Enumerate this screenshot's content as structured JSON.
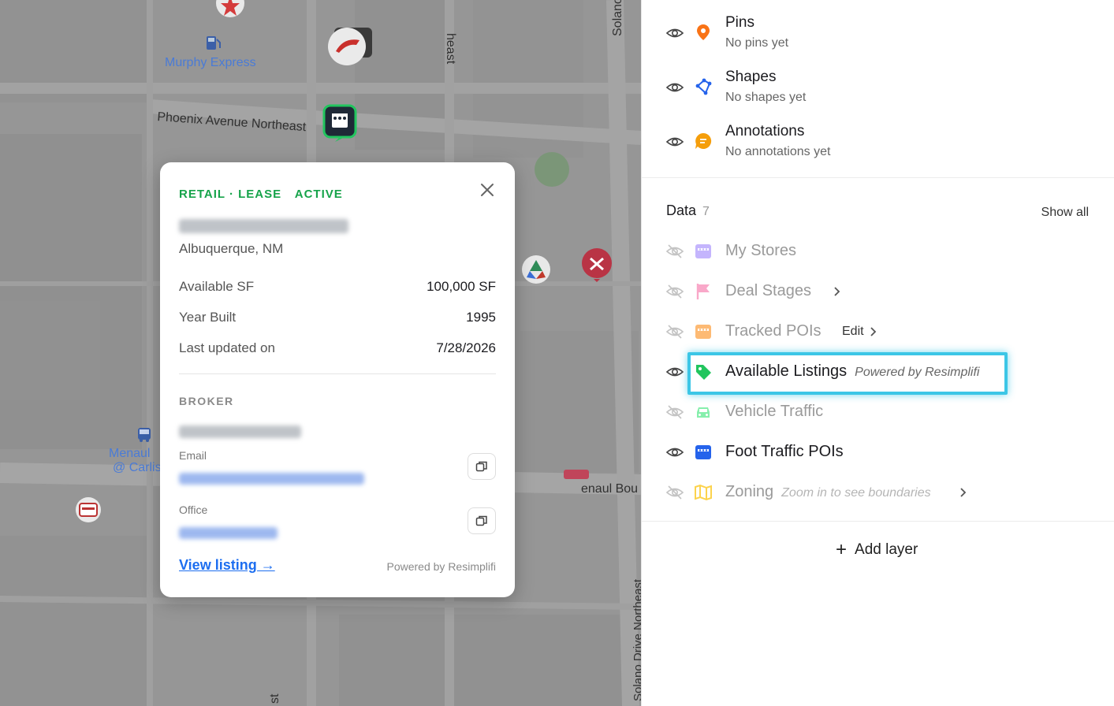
{
  "map": {
    "labels": {
      "murphy": "Murphy Express",
      "phoenix": "Phoenix Avenue Northeast",
      "menaul_1": "Menaul",
      "menaul_2": "@ Carlis",
      "renaul": "enaul Bou",
      "solano_top": "Solano",
      "east_top": "heast",
      "solano_drive": "Solano Drive Northeast",
      "st_bottom": "st"
    }
  },
  "popup": {
    "tags": {
      "category": "RETAIL · LEASE",
      "status": "ACTIVE"
    },
    "city": "Albuquerque, NM",
    "rows": [
      {
        "label": "Available SF",
        "value": "100,000 SF"
      },
      {
        "label": "Year Built",
        "value": "1995"
      },
      {
        "label": "Last updated on",
        "value": "7/28/2026"
      }
    ],
    "broker": {
      "section": "BROKER",
      "email_label": "Email",
      "office_label": "Office"
    },
    "view_listing": "View listing →",
    "powered": "Powered by Resimplifi"
  },
  "panel": {
    "user_layers": [
      {
        "title": "Pins",
        "subtitle": "No pins yet"
      },
      {
        "title": "Shapes",
        "subtitle": "No shapes yet"
      },
      {
        "title": "Annotations",
        "subtitle": "No annotations yet"
      }
    ],
    "data_header": {
      "label": "Data",
      "count": "7",
      "show_all": "Show all"
    },
    "data_layers": [
      {
        "title": "My Stores"
      },
      {
        "title": "Deal Stages"
      },
      {
        "title": "Tracked POIs",
        "action": "Edit"
      },
      {
        "title": "Available Listings",
        "note": "Powered by Resimplifi"
      },
      {
        "title": "Vehicle Traffic"
      },
      {
        "title": "Foot Traffic POIs"
      },
      {
        "title": "Zoning",
        "note": "Zoom in to see boundaries"
      }
    ],
    "add_layer": "Add layer"
  },
  "colors": {
    "accent_green": "#16a34a",
    "highlight": "#3cc6e6",
    "link_blue": "#1d6ef0"
  }
}
